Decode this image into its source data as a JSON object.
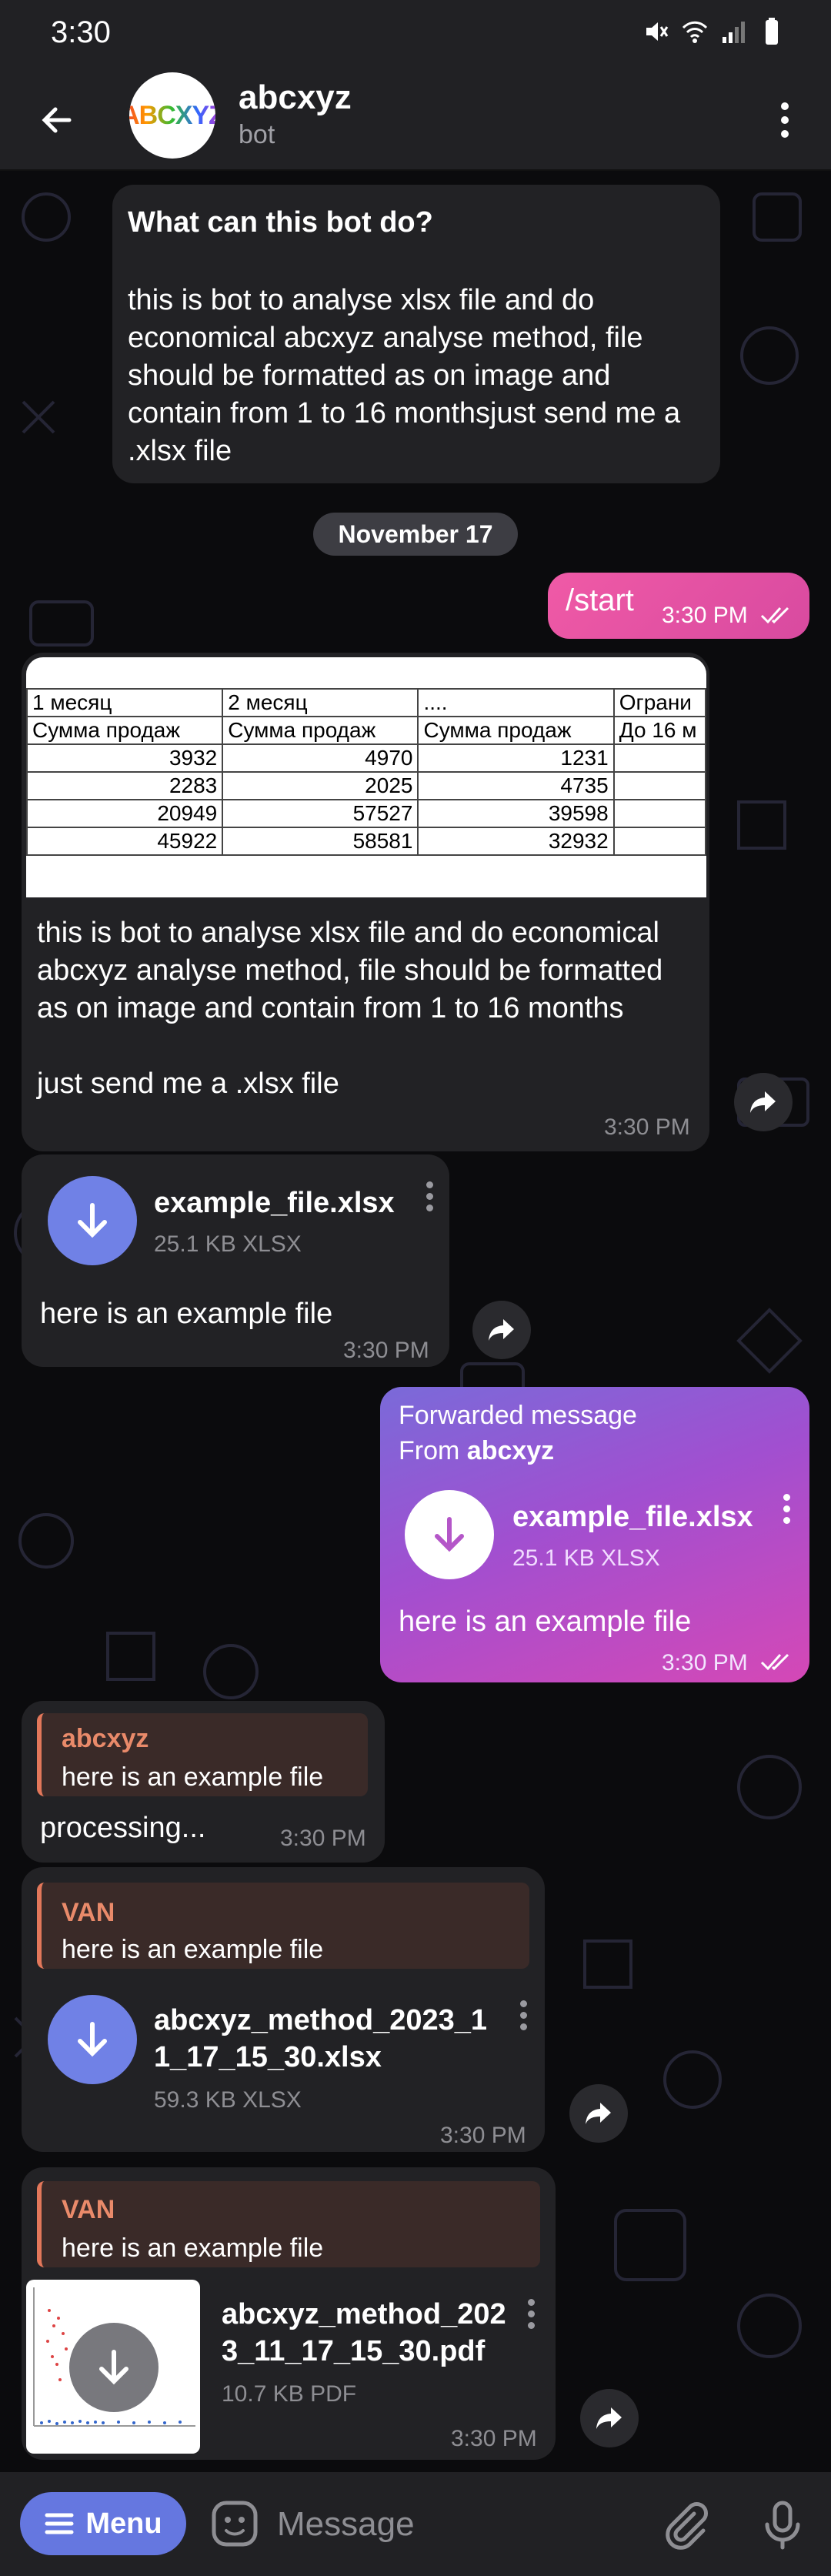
{
  "status_bar": {
    "time": "3:30"
  },
  "header": {
    "title": "abcxyz",
    "subtitle": "bot",
    "avatar_text": "ABCXYZ"
  },
  "bot_info": {
    "title": "What can this bot do?",
    "text": "this is bot to analyse xlsx file and do economical abcxyz analyse method, file should be formatted as on image and contain from 1 to 16 monthsjust send me a .xlsx file"
  },
  "date_chip": "November 17",
  "messages": {
    "start": {
      "text": "/start",
      "time": "3:30 PM"
    },
    "image_msg": {
      "sheet": {
        "headers": [
          "1 месяц",
          "2 месяц",
          "....",
          "Ограни"
        ],
        "subheaders": [
          "Сумма продаж",
          "Сумма продаж",
          "Сумма продаж",
          "До 16 м"
        ],
        "rows": [
          [
            "3932",
            "4970",
            "1231",
            ""
          ],
          [
            "2283",
            "2025",
            "4735",
            ""
          ],
          [
            "20949",
            "57527",
            "39598",
            ""
          ],
          [
            "45922",
            "58581",
            "32932",
            ""
          ]
        ]
      },
      "text_1": "this is bot to analyse xlsx file and do economical abcxyz analyse method, file should be formatted as on image and contain from 1 to 16 months",
      "text_2": "just send me a .xlsx file",
      "time": "3:30 PM"
    },
    "file1": {
      "name": "example_file.xlsx",
      "size": "25.1 KB XLSX",
      "caption": "here is an example file",
      "time": "3:30 PM"
    },
    "forwarded": {
      "label": "Forwarded message",
      "from_prefix": "From ",
      "from_name": "abcxyz",
      "name": "example_file.xlsx",
      "size": "25.1 KB XLSX",
      "caption": "here is an example file",
      "time": "3:30 PM"
    },
    "processing": {
      "reply_name": "abcxyz",
      "reply_text": "here is an example file",
      "text": "processing...",
      "time": "3:30 PM"
    },
    "result_xlsx": {
      "reply_name": "VAN",
      "reply_text": "here is an example file",
      "name_line1": "abcxyz_method_2023_1",
      "name_line2": "1_17_15_30.xlsx",
      "size": "59.3 KB XLSX",
      "time": "3:30 PM"
    },
    "result_pdf": {
      "reply_name": "VAN",
      "reply_text": "here is an example file",
      "name_line1": "abcxyz_method_202",
      "name_line2": "3_11_17_15_30.pdf",
      "size": "10.7 KB PDF",
      "time": "3:30 PM"
    }
  },
  "input_bar": {
    "menu_label": "Menu",
    "placeholder": "Message"
  },
  "colors": {
    "accent": "#6577e0",
    "bubble_in": "#222225",
    "reply_name": "#e98a6a"
  }
}
